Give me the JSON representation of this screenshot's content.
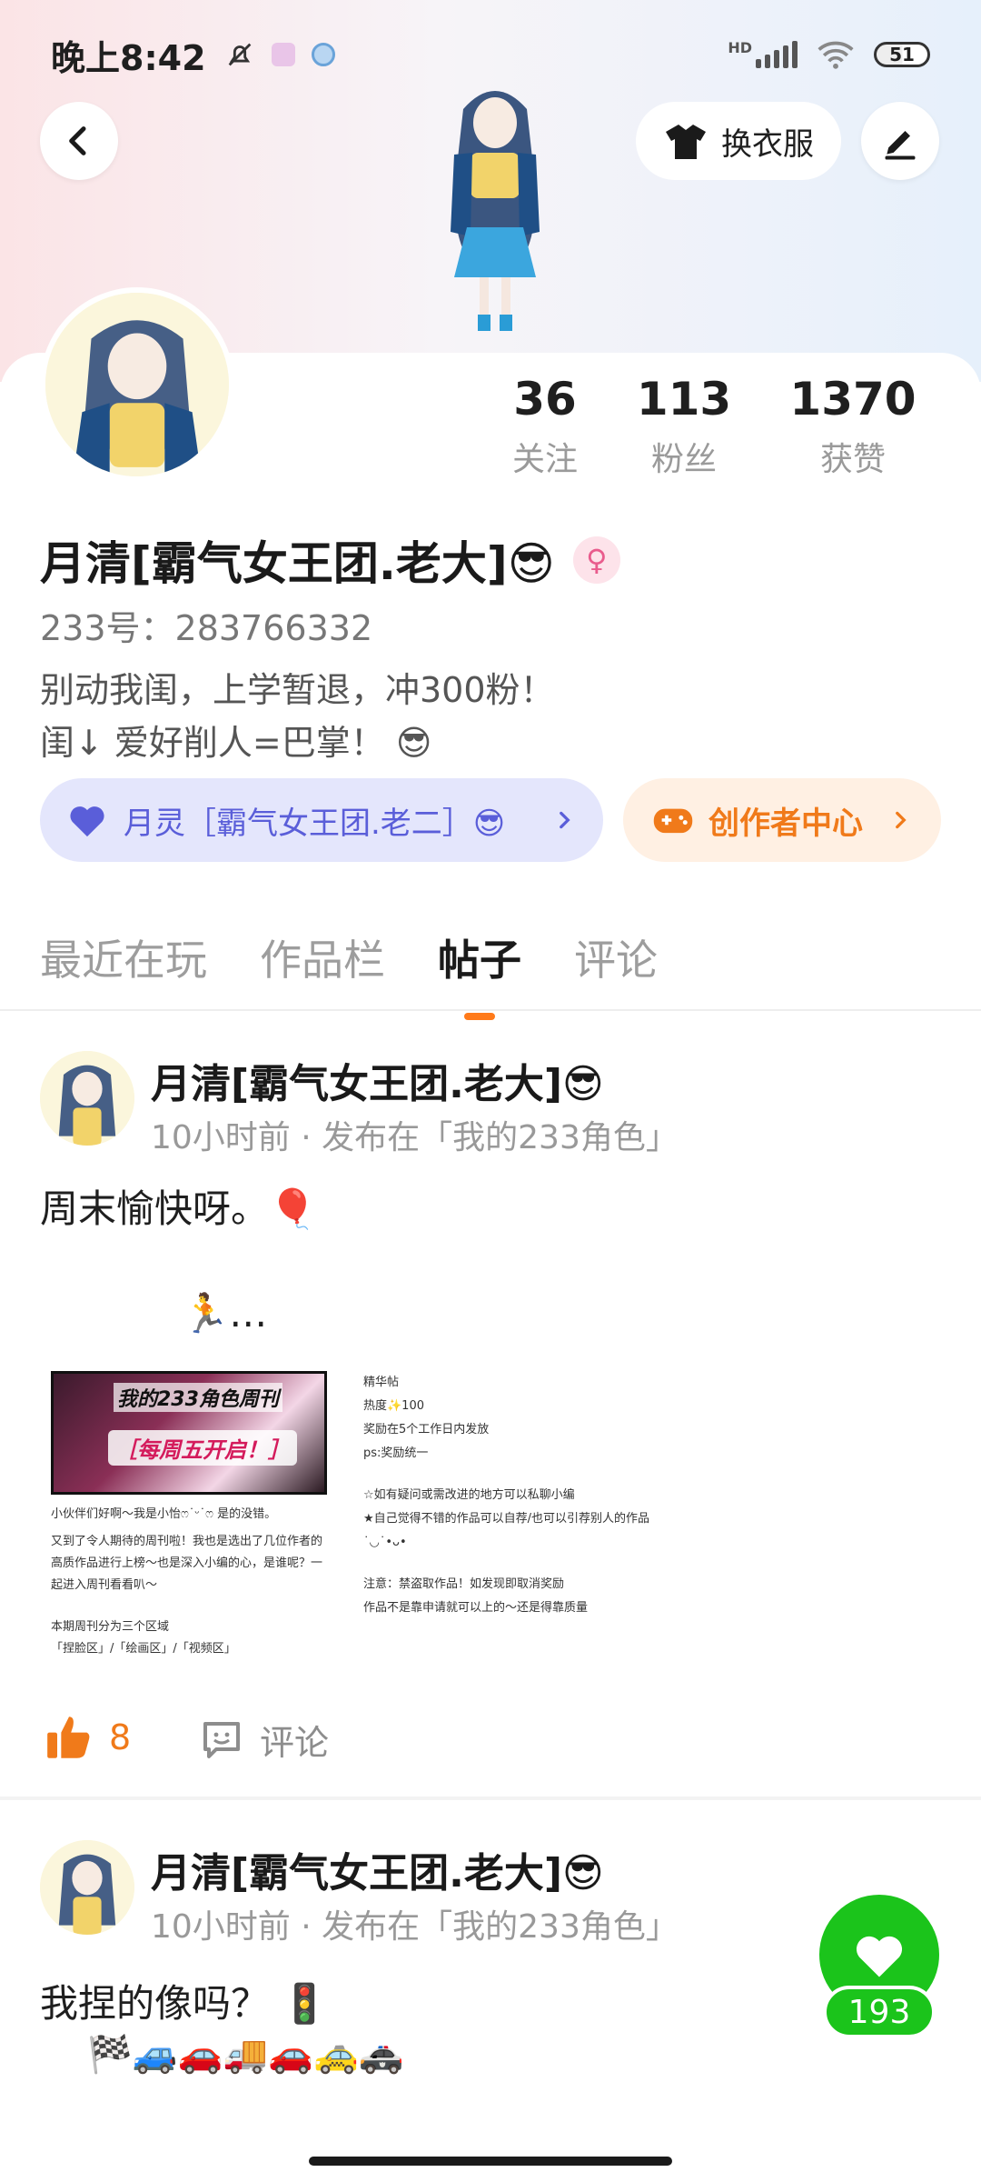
{
  "status_bar": {
    "time": "晚上8:42",
    "network": "HD",
    "battery": "51"
  },
  "header": {
    "outfit_button": "换衣服"
  },
  "profile": {
    "stats": [
      {
        "value": "36",
        "label": "关注"
      },
      {
        "value": "113",
        "label": "粉丝"
      },
      {
        "value": "1370",
        "label": "获赞"
      }
    ],
    "username": "月清[霸气女王团.老大]😎",
    "gender_symbol": "♀",
    "uid": "233号：283766332",
    "bio_line1": "别动我闺，上学暂退，冲300粉！",
    "bio_line2": "闺↓ 爱好削人=巴掌！ 😎"
  },
  "chips": {
    "group_label": "月灵［霸气女王团.老二］😎",
    "creator_label": "创作者中心"
  },
  "tabs": [
    {
      "label": "最近在玩",
      "active": false
    },
    {
      "label": "作品栏",
      "active": false
    },
    {
      "label": "帖子",
      "active": true
    },
    {
      "label": "评论",
      "active": false
    }
  ],
  "posts": [
    {
      "author": "月清[霸气女王团.老大]😎",
      "meta": "10小时前 · 发布在「我的233角色」",
      "text": "周末愉快呀。🎈",
      "text2": "🏃…",
      "attachment": {
        "poster_title": "我的233角色周刊",
        "poster_sub": "［每周五开启！］",
        "left_lines": [
          "小伙伴们好啊～我是小怡ෆ˙ᵕ˙ෆ 是的没错。",
          "又到了令人期待的周刊啦！我也是选出了几位作者的高质作品进行上榜～也是深入小编的心，是谁呢？一起进入周刊看看叭～",
          "本期周刊分为三个区域",
          "「捏脸区」/「绘画区」/「视频区」"
        ],
        "right_lines": [
          "精华帖",
          "热度✨100",
          "奖励在5个工作日内发放",
          "ps:奖励统一",
          "☆如有疑问或需改进的地方可以私聊小编",
          "★自己觉得不错的作品可以自荐/也可以引荐别人的作品˙◡˙•ᴗ•",
          "注意：禁盗取作品！如发现即取消奖励",
          "作品不是靠申请就可以上的～还是得靠质量"
        ]
      },
      "likes": "8",
      "comment_label": "评论"
    },
    {
      "author": "月清[霸气女王团.老大]😎",
      "meta": "10小时前 · 发布在「我的233角色」",
      "text": "我捏的像吗？ 🚦",
      "emoji_row": "🏁🚙🚗🚚🚗🚕🚓"
    }
  ],
  "floating_like": {
    "count": "193",
    "color": "#1bc41b"
  },
  "colors": {
    "accent": "#ff7a1a",
    "group_chip_text": "#5a5ed9",
    "creator_chip_text": "#f07a1a"
  },
  "icons": {
    "back": "chevron-left-icon",
    "outfit": "tshirt-icon",
    "edit": "pen-icon",
    "heart": "heart-icon",
    "gamepad": "gamepad-icon",
    "like": "thumbs-up-icon",
    "comment": "comment-icon"
  }
}
